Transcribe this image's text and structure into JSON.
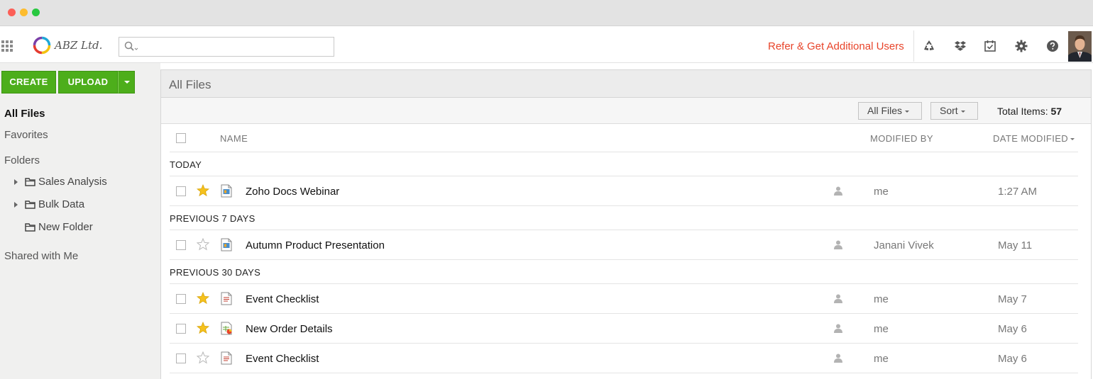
{
  "brand": {
    "logo_text": "ABZ Ltd.",
    "accent_color": "#4dae1b",
    "link_color": "#e8442a"
  },
  "header": {
    "search_placeholder": "",
    "refer_link": "Refer & Get Additional Users",
    "icons": [
      "recycle-icon",
      "dropbox-icon",
      "tasks-icon",
      "gear-icon",
      "help-icon"
    ]
  },
  "sidebar": {
    "create_label": "CREATE",
    "upload_label": "UPLOAD",
    "nav": {
      "all_files": "All Files",
      "favorites": "Favorites",
      "folders": "Folders",
      "shared": "Shared with Me"
    },
    "folders": [
      {
        "name": "Sales Analysis",
        "expandable": true
      },
      {
        "name": "Bulk Data",
        "expandable": true
      },
      {
        "name": "New Folder",
        "expandable": false
      }
    ]
  },
  "main": {
    "title": "All Files",
    "filter_label": "All Files",
    "sort_label": "Sort",
    "total_label": "Total Items:",
    "total_count": "57",
    "columns": {
      "name": "NAME",
      "modified_by": "MODIFIED BY",
      "date_modified": "DATE MODIFIED"
    },
    "groups": [
      {
        "label": "TODAY",
        "files": [
          {
            "name": "Zoho Docs Webinar",
            "starred": true,
            "type": "presentation",
            "modified_by": "me",
            "date": "1:27 AM"
          }
        ]
      },
      {
        "label": "PREVIOUS 7 DAYS",
        "files": [
          {
            "name": "Autumn Product Presentation",
            "starred": false,
            "type": "presentation",
            "modified_by": "Janani Vivek",
            "date": "May 11"
          }
        ]
      },
      {
        "label": "PREVIOUS 30 DAYS",
        "files": [
          {
            "name": "Event Checklist",
            "starred": true,
            "type": "document",
            "modified_by": "me",
            "date": "May 7"
          },
          {
            "name": "New Order Details",
            "starred": true,
            "type": "spreadsheet",
            "modified_by": "me",
            "date": "May 6"
          },
          {
            "name": "Event Checklist",
            "starred": false,
            "type": "document",
            "modified_by": "me",
            "date": "May 6"
          }
        ]
      }
    ]
  }
}
